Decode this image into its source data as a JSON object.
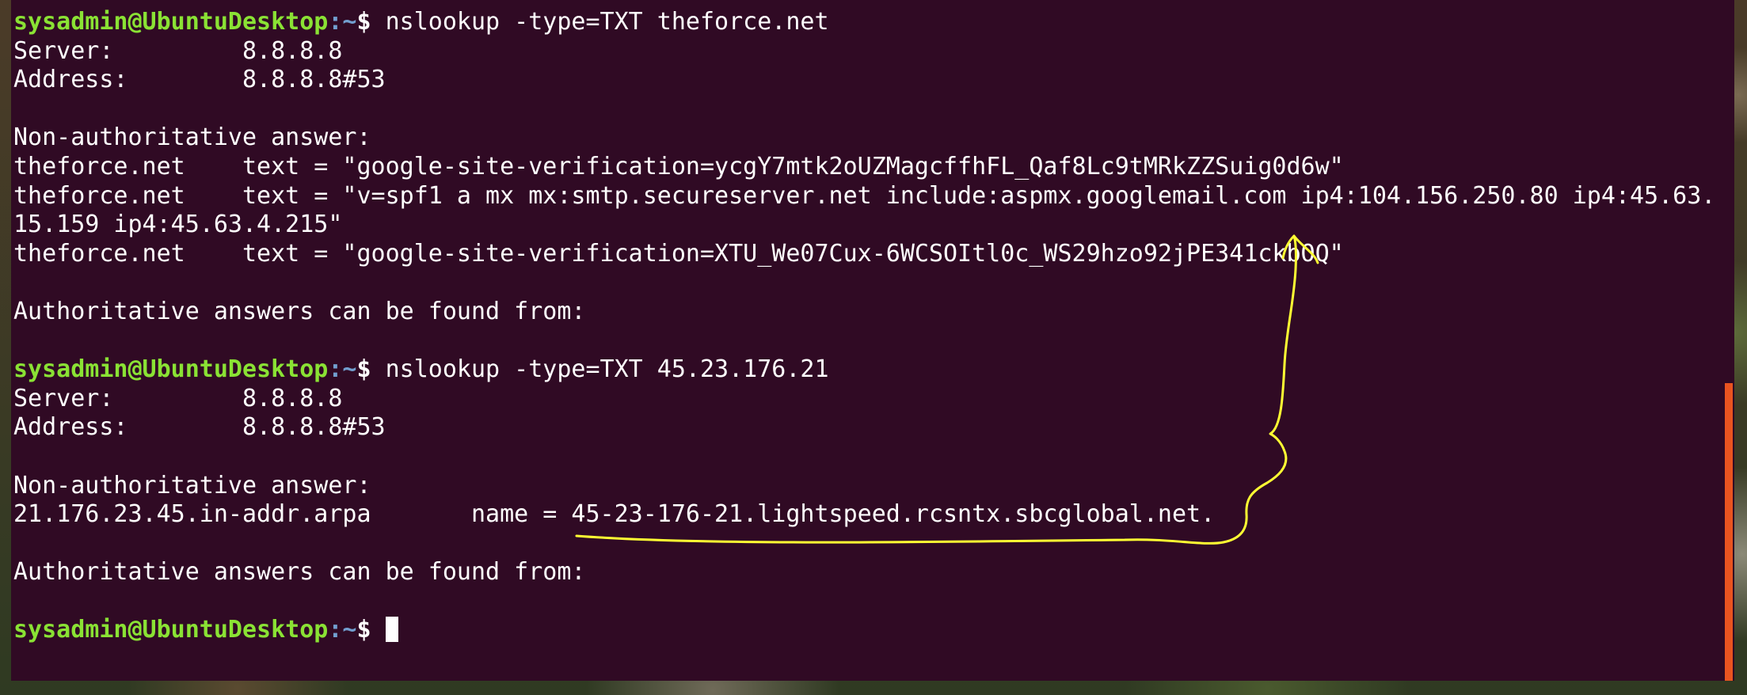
{
  "prompt": {
    "user_host": "sysadmin@UbuntuDesktop",
    "path": ":~",
    "symbol": "$"
  },
  "lines": [
    {
      "kind": "cmd",
      "text": " nslookup -type=TXT theforce.net"
    },
    {
      "kind": "out",
      "text": "Server:         8.8.8.8"
    },
    {
      "kind": "out",
      "text": "Address:        8.8.8.8#53"
    },
    {
      "kind": "blank",
      "text": ""
    },
    {
      "kind": "out",
      "text": "Non-authoritative answer:"
    },
    {
      "kind": "out",
      "text": "theforce.net    text = \"google-site-verification=ycgY7mtk2oUZMagcffhFL_Qaf8Lc9tMRkZZSuig0d6w\""
    },
    {
      "kind": "out",
      "text": "theforce.net    text = \"v=spf1 a mx mx:smtp.secureserver.net include:aspmx.googlemail.com ip4:104.156.250.80 ip4:45.63."
    },
    {
      "kind": "out",
      "text": "15.159 ip4:45.63.4.215\""
    },
    {
      "kind": "out",
      "text": "theforce.net    text = \"google-site-verification=XTU_We07Cux-6WCSOItl0c_WS29hzo92jPE341ckbOQ\""
    },
    {
      "kind": "blank",
      "text": ""
    },
    {
      "kind": "out",
      "text": "Authoritative answers can be found from:"
    },
    {
      "kind": "blank",
      "text": ""
    },
    {
      "kind": "cmd",
      "text": " nslookup -type=TXT 45.23.176.21"
    },
    {
      "kind": "out",
      "text": "Server:         8.8.8.8"
    },
    {
      "kind": "out",
      "text": "Address:        8.8.8.8#53"
    },
    {
      "kind": "blank",
      "text": ""
    },
    {
      "kind": "out",
      "text": "Non-authoritative answer:"
    },
    {
      "kind": "out",
      "text": "21.176.23.45.in-addr.arpa       name = 45-23-176-21.lightspeed.rcsntx.sbcglobal.net."
    },
    {
      "kind": "blank",
      "text": ""
    },
    {
      "kind": "out",
      "text": "Authoritative answers can be found from:"
    },
    {
      "kind": "blank",
      "text": ""
    },
    {
      "kind": "cmd",
      "text": " "
    }
  ],
  "colors": {
    "terminal_bg": "#300a24",
    "prompt_user": "#8ae234",
    "prompt_path": "#729fcf",
    "annotation": "#ffff33",
    "scrollbar": "#e95420"
  },
  "icons": [
    "cursor-block",
    "scrollbar-thumb"
  ]
}
